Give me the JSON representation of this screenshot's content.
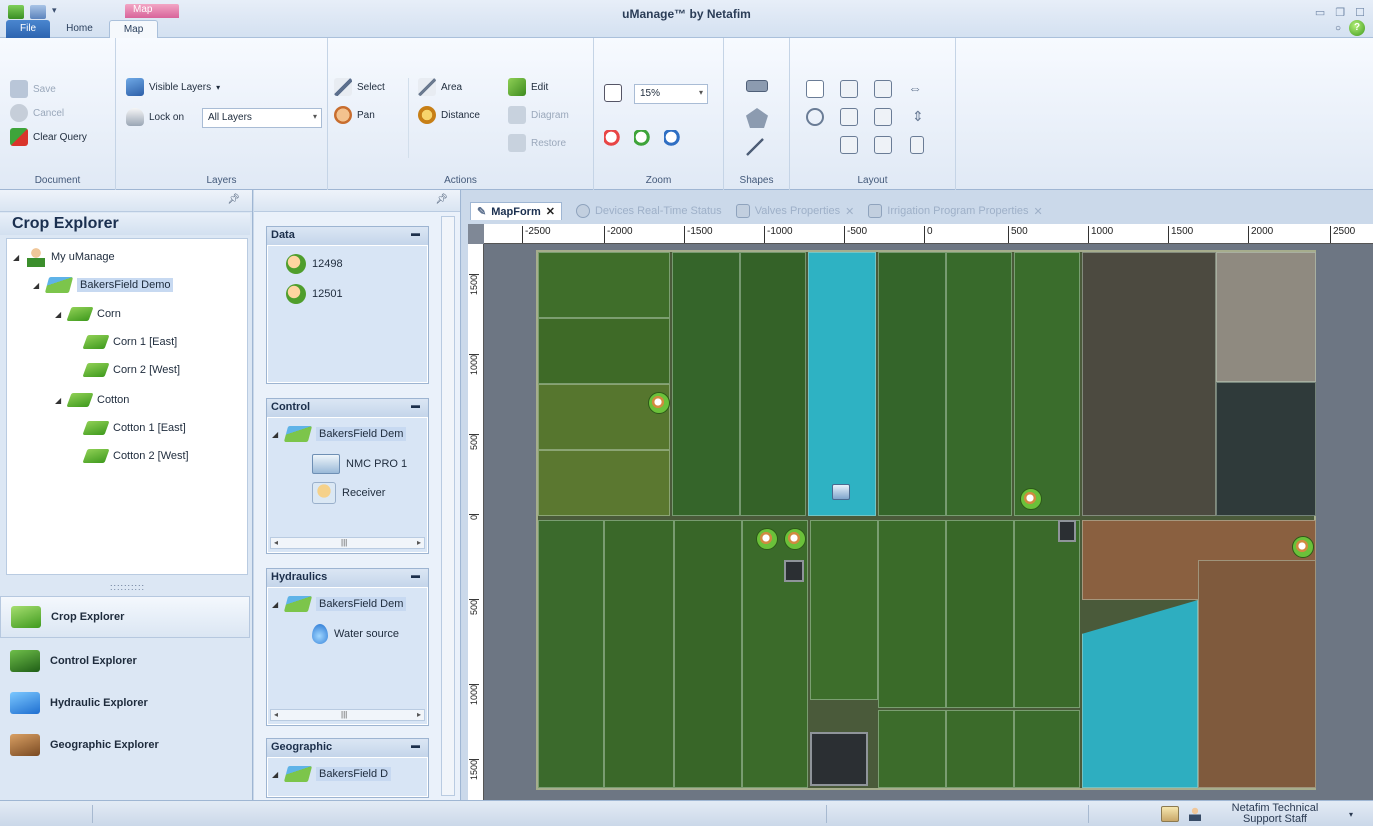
{
  "app": {
    "title": "uManage™ by Netafim",
    "context_tab": "Map",
    "tabs": [
      "File",
      "Home",
      "Map"
    ],
    "active_tab": "Map"
  },
  "ribbon": {
    "document": {
      "label": "Document",
      "save": "Save",
      "cancel": "Cancel",
      "clear_query": "Clear Query"
    },
    "layers": {
      "label": "Layers",
      "visible_layers": "Visible Layers",
      "lock_on": "Lock on",
      "lock_on_value": "All Layers"
    },
    "actions": {
      "label": "Actions",
      "select": "Select",
      "pan": "Pan",
      "area": "Area",
      "distance": "Distance",
      "edit": "Edit",
      "diagram": "Diagram",
      "restore": "Restore"
    },
    "zoom": {
      "label": "Zoom",
      "value": "15%"
    },
    "shapes": {
      "label": "Shapes"
    },
    "layout": {
      "label": "Layout"
    }
  },
  "crop_explorer": {
    "title": "Crop Explorer",
    "tree": [
      {
        "label": "My uManage",
        "level": 0
      },
      {
        "label": "BakersField Demo",
        "level": 1
      },
      {
        "label": "Corn",
        "level": 2
      },
      {
        "label": "Corn 1 [East]",
        "level": 3
      },
      {
        "label": "Corn 2 [West]",
        "level": 3
      },
      {
        "label": "Cotton",
        "level": 2
      },
      {
        "label": "Cotton 1 [East]",
        "level": 3
      },
      {
        "label": "Cotton 2 [West]",
        "level": 3
      }
    ],
    "nav": [
      "Crop Explorer",
      "Control Explorer",
      "Hydraulic Explorer",
      "Geographic Explorer"
    ]
  },
  "side_panels": {
    "data": {
      "title": "Data",
      "items": [
        "12498",
        "12501"
      ]
    },
    "control": {
      "title": "Control",
      "items": [
        "BakersField Dem",
        "NMC PRO 1",
        "Receiver"
      ]
    },
    "hydraulics": {
      "title": "Hydraulics",
      "items": [
        "BakersField Dem",
        "Water source"
      ]
    },
    "geographic": {
      "title": "Geographic",
      "items": [
        "BakersField D"
      ]
    }
  },
  "document_tabs": [
    "MapForm",
    "Devices Real-Time Status",
    "Valves Properties",
    "Irrigation Program Properties"
  ],
  "map": {
    "ruler_x": [
      "-2500",
      "-2000",
      "-1500",
      "-1000",
      "-500",
      "0",
      "500",
      "1000",
      "1500",
      "2000",
      "2500"
    ],
    "ruler_y": [
      "1500",
      "1000",
      "500",
      "0",
      "500",
      "1000",
      "1500"
    ]
  },
  "status": {
    "user": "Netafim Technical Support Staff"
  },
  "colors": {
    "ribbon_bg": "#e9f0f9",
    "accent_blue": "#2d64b0",
    "context_pink": "#d8649a",
    "field_green": "#3f6f2a",
    "water_cyan": "#2fb5c8",
    "soil_brown": "#8a6040"
  }
}
